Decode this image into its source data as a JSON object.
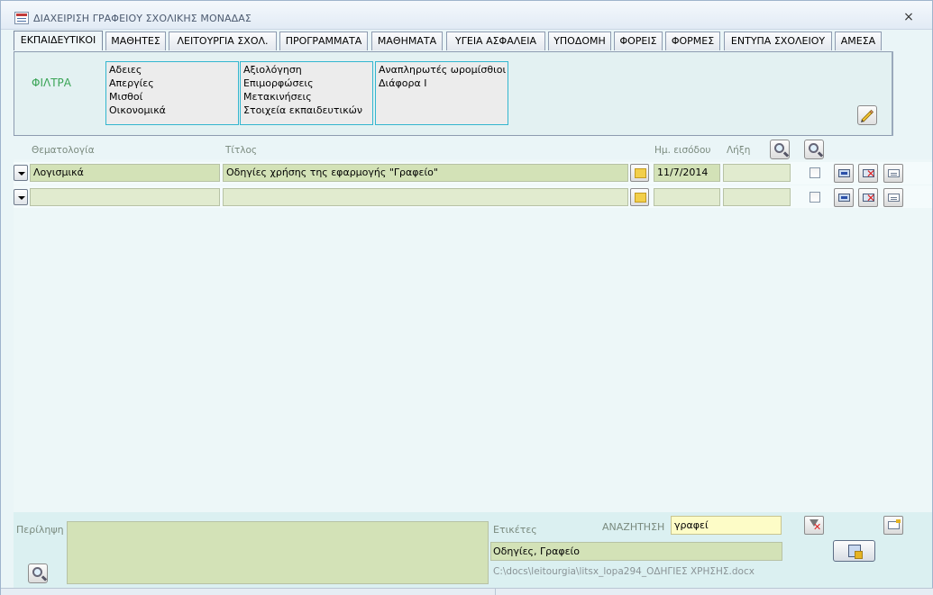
{
  "window": {
    "title": "ΔΙΑΧΕΙΡΙΣΗ ΓΡΑΦΕΙΟΥ ΣΧΟΛΙΚΗΣ ΜΟΝΑΔΑΣ",
    "close_glyph": "×"
  },
  "tabs": [
    {
      "label": "ΕΚΠΑΙΔΕΥΤΙΚΟΙ",
      "active": true
    },
    {
      "label": "ΜΑΘΗΤΕΣ"
    },
    {
      "label": "ΛΕΙΤΟΥΡΓΙΑ ΣΧΟΛ."
    },
    {
      "label": "ΠΡΟΓΡΑΜΜΑΤΑ"
    },
    {
      "label": "ΜΑΘΗΜΑΤΑ"
    },
    {
      "label": "ΥΓΕΙΑ ΑΣΦΑΛΕΙΑ"
    },
    {
      "label": "ΥΠΟΔΟΜΗ"
    },
    {
      "label": "ΦΟΡΕΙΣ"
    },
    {
      "label": "ΦΟΡΜΕΣ"
    },
    {
      "label": "ΕΝΤΥΠΑ ΣΧΟΛΕΙΟΥ"
    },
    {
      "label": "ΑΜΕΣΑ"
    }
  ],
  "filters": {
    "label": "ΦΙΛΤΡΑ",
    "box1": [
      "Αδειες",
      "Απεργίες",
      "Μισθοί",
      "Οικονομικά"
    ],
    "box2": [
      "Αξιολόγηση",
      "Επιμορφώσεις",
      "Μετακινήσεις",
      "Στοιχεία εκπαιδευτικών"
    ],
    "box3": [
      "Αναπληρωτές  ωρομίσθιοι",
      "Διάφορα Ι"
    ]
  },
  "columns": {
    "subject": "Θεματολογία",
    "title": "Τίτλος",
    "entry_date": "Ημ. εισόδου",
    "expiry": "Λήξη"
  },
  "rows": [
    {
      "subject": "Λογισμικά",
      "title": "Οδηγίες χρήσης της εφαρμογής \"Γραφείο\"",
      "entry_date": "11/7/2014",
      "expiry": ""
    },
    {
      "subject": "",
      "title": "",
      "entry_date": "",
      "expiry": ""
    }
  ],
  "bottom": {
    "summary_label": "Περίληψη",
    "summary_value": "",
    "tags_label": "Ετικέτες",
    "tags_value": "Οδηγίες, Γραφείο",
    "search_label": "ΑΝΑΖΗΤΗΣΗ",
    "search_value": "γραφεί",
    "file_path": "C:\\docs\\leitourgia\\litsx_lopa294_ΟΔΗΓΙΕΣ ΧΡΗΣΗΣ.docx"
  }
}
